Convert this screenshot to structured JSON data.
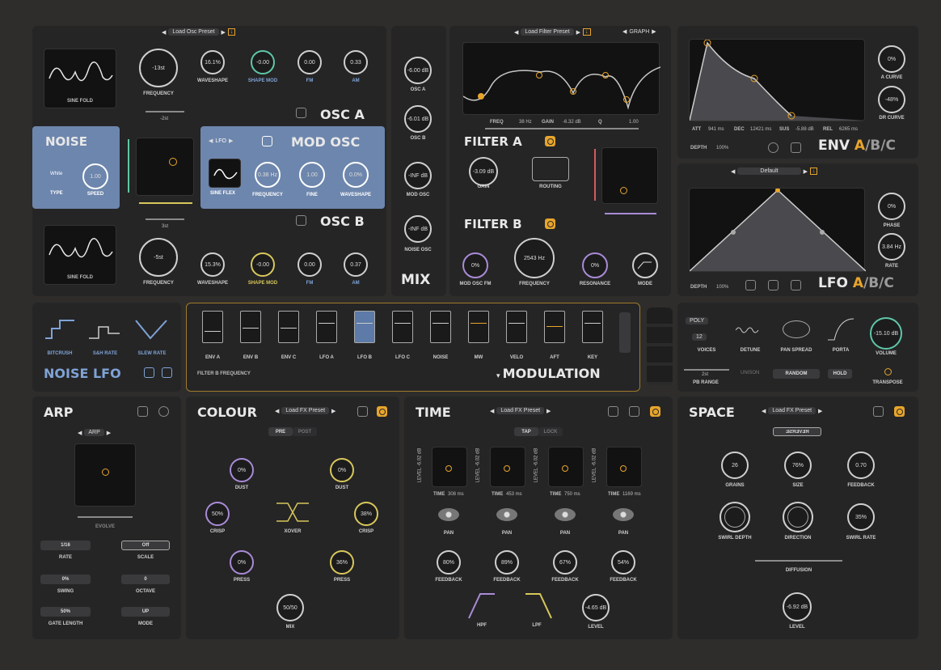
{
  "colors": {
    "accent": "#e8a52b",
    "blue_panel": "#6d86ad",
    "purple": "#a98bd6",
    "yellow": "#d8c75a",
    "teal": "#5fc7a6"
  },
  "osc_a": {
    "preset": "Load Osc Preset",
    "wavetable": "SINE FOLD",
    "frequency": "-13st",
    "frequency_label": "FREQUENCY",
    "fine": "-2st",
    "waveshape": "16.1%",
    "waveshape_label": "WAVESHAPE",
    "shape_mod": "-0.00",
    "shape_mod_label": "SHAPE MOD",
    "fm": "0.00",
    "fm_label": "FM",
    "am": "0.33",
    "am_label": "AM",
    "title": "OSC A"
  },
  "osc_b": {
    "wavetable": "SINE FOLD",
    "frequency": "-5st",
    "frequency_label": "FREQUENCY",
    "fine": "3st",
    "waveshape": "15.3%",
    "waveshape_label": "WAVESHAPE",
    "shape_mod": "-0.00",
    "shape_mod_label": "SHAPE MOD",
    "fm": "0.00",
    "fm_label": "FM",
    "am": "0.37",
    "am_label": "AM",
    "title": "OSC B"
  },
  "noise": {
    "title": "NOISE",
    "type": "White",
    "type_label": "TYPE",
    "speed": "1.00",
    "speed_label": "SPEED"
  },
  "mod_osc": {
    "mode": "LFO",
    "title": "MOD OSC",
    "wave": "SINE FLEX",
    "frequency": "0.38 Hz",
    "frequency_label": "FREQUENCY",
    "fine": "1.00",
    "fine_label": "FINE",
    "waveshape": "0.0%",
    "waveshape_label": "WAVESHAPE"
  },
  "mix": {
    "title": "MIX",
    "osc_a": "-6.00 dB",
    "osc_a_label": "OSC A",
    "osc_b": "-6.01 dB",
    "osc_b_label": "OSC B",
    "mod_osc": "-INF dB",
    "mod_osc_label": "MOD OSC",
    "noise_osc": "-INF dB",
    "noise_osc_label": "NOISE OSC"
  },
  "filter": {
    "preset": "Load Filter Preset",
    "graph": "GRAPH",
    "freq_label": "FREQ",
    "freq": "38 Hz",
    "gain_label": "GAIN",
    "gain": "-6.32 dB",
    "q_label": "Q",
    "q": "1.00",
    "title_a": "FILTER A",
    "title_b": "FILTER B",
    "gain_knob": "-3.09 dB",
    "gain_knob_label": "GAIN",
    "routing_label": "ROUTING",
    "mod_osc_fm": "0%",
    "mod_osc_fm_label": "MOD OSC FM",
    "frequency": "2543 Hz",
    "frequency_label": "FREQUENCY",
    "resonance": "0%",
    "resonance_label": "RESONANCE",
    "mode_label": "MODE"
  },
  "env": {
    "att_label": "ATT",
    "att": "941 ms",
    "dec_label": "DEC",
    "dec": "12421 ms",
    "sus_label": "SUS",
    "sus": "-5.88 dB",
    "rel_label": "REL",
    "rel": "6265 ms",
    "depth_label": "DEPTH",
    "depth": "100%",
    "a_curve": "0%",
    "a_curve_label": "A CURVE",
    "dr_curve": "-48%",
    "dr_curve_label": "DR CURVE",
    "title": "ENV",
    "sel_a": "A",
    "sel_b": "/B/C"
  },
  "lfo": {
    "preset": "Default",
    "depth_label": "DEPTH",
    "depth": "100%",
    "phase": "0%",
    "phase_label": "PHASE",
    "rate": "3.84 Hz",
    "rate_label": "RATE",
    "title": "LFO",
    "sel_a": "A",
    "sel_b": "/B/C"
  },
  "noise_lfo": {
    "title": "NOISE LFO",
    "bitcrush": "BITCRUSH",
    "sh_rate": "S&H RATE",
    "slew_rate": "SLEW RATE"
  },
  "modulation": {
    "title": "MODULATION",
    "target": "FILTER B FREQUENCY",
    "sources": [
      "ENV A",
      "ENV B",
      "ENV C",
      "LFO A",
      "LFO B",
      "LFO C",
      "NOISE",
      "MW",
      "VELO",
      "AFT",
      "KEY"
    ]
  },
  "voice": {
    "poly": "POLY",
    "voices": "12",
    "voices_label": "VOICES",
    "detune_label": "DETUNE",
    "pan_spread_label": "PAN SPREAD",
    "porta_label": "PORTA",
    "volume": "-15.10 dB",
    "volume_label": "VOLUME",
    "pb_range": "2st",
    "pb_range_label": "PB RANGE",
    "unison": "UNISON",
    "random": "RANDOM",
    "hold": "HOLD",
    "transpose_label": "TRANSPOSE"
  },
  "arp": {
    "title": "ARP",
    "mode_sel": "ARP",
    "evolve": "EVOLVE",
    "rate": "1/16",
    "rate_label": "RATE",
    "scale": "Off",
    "scale_label": "SCALE",
    "swing": "0%",
    "swing_label": "SWING",
    "octave": "0",
    "octave_label": "OCTAVE",
    "gate": "50%",
    "gate_label": "GATE LENGTH",
    "mode": "UP",
    "mode_label": "MODE"
  },
  "colour": {
    "title": "COLOUR",
    "preset": "Load FX Preset",
    "pre": "PRE",
    "post": "POST",
    "dust1": "0%",
    "dust1_label": "DUST",
    "dust2": "0%",
    "dust2_label": "DUST",
    "crisp1": "50%",
    "crisp1_label": "CRISP",
    "crisp2": "38%",
    "crisp2_label": "CRISP",
    "xover_label": "XOVER",
    "press1": "0%",
    "press1_label": "PRESS",
    "press2": "36%",
    "press2_label": "PRESS",
    "mix": "50/50",
    "mix_label": "MIX"
  },
  "time": {
    "title": "TIME",
    "preset": "Load FX Preset",
    "tap": "TAP",
    "lock": "LOCK",
    "taps": [
      {
        "level": "LEVEL -6.02 dB",
        "time_label": "TIME",
        "time": "308 ms",
        "pan_label": "PAN",
        "feedback": "80%",
        "feedback_label": "FEEDBACK"
      },
      {
        "level": "LEVEL -6.02 dB",
        "time_label": "TIME",
        "time": "453 ms",
        "pan_label": "PAN",
        "feedback": "89%",
        "feedback_label": "FEEDBACK"
      },
      {
        "level": "LEVEL -6.02 dB",
        "time_label": "TIME",
        "time": "750 ms",
        "pan_label": "PAN",
        "feedback": "67%",
        "feedback_label": "FEEDBACK"
      },
      {
        "level": "LEVEL -6.02 dB",
        "time_label": "TIME",
        "time": "1169 ms",
        "pan_label": "PAN",
        "feedback": "54%",
        "feedback_label": "FEEDBACK"
      }
    ],
    "hpf_label": "HPF",
    "lpf_label": "LPF",
    "level": "-4.65 dB",
    "level_label": "LEVEL"
  },
  "space": {
    "title": "SPACE",
    "preset": "Load FX Preset",
    "reverse": "REVERSE",
    "grains": "26",
    "grains_label": "GRAINS",
    "size": "76%",
    "size_label": "SIZE",
    "feedback": "0.70",
    "feedback_label": "FEEDBACK",
    "swirl_depth_label": "SWIRL DEPTH",
    "direction_label": "DIRECTION",
    "swirl_rate": "35%",
    "swirl_rate_label": "SWIRL RATE",
    "diffusion_label": "DIFFUSION",
    "level": "-6.92 dB",
    "level_label": "LEVEL"
  }
}
